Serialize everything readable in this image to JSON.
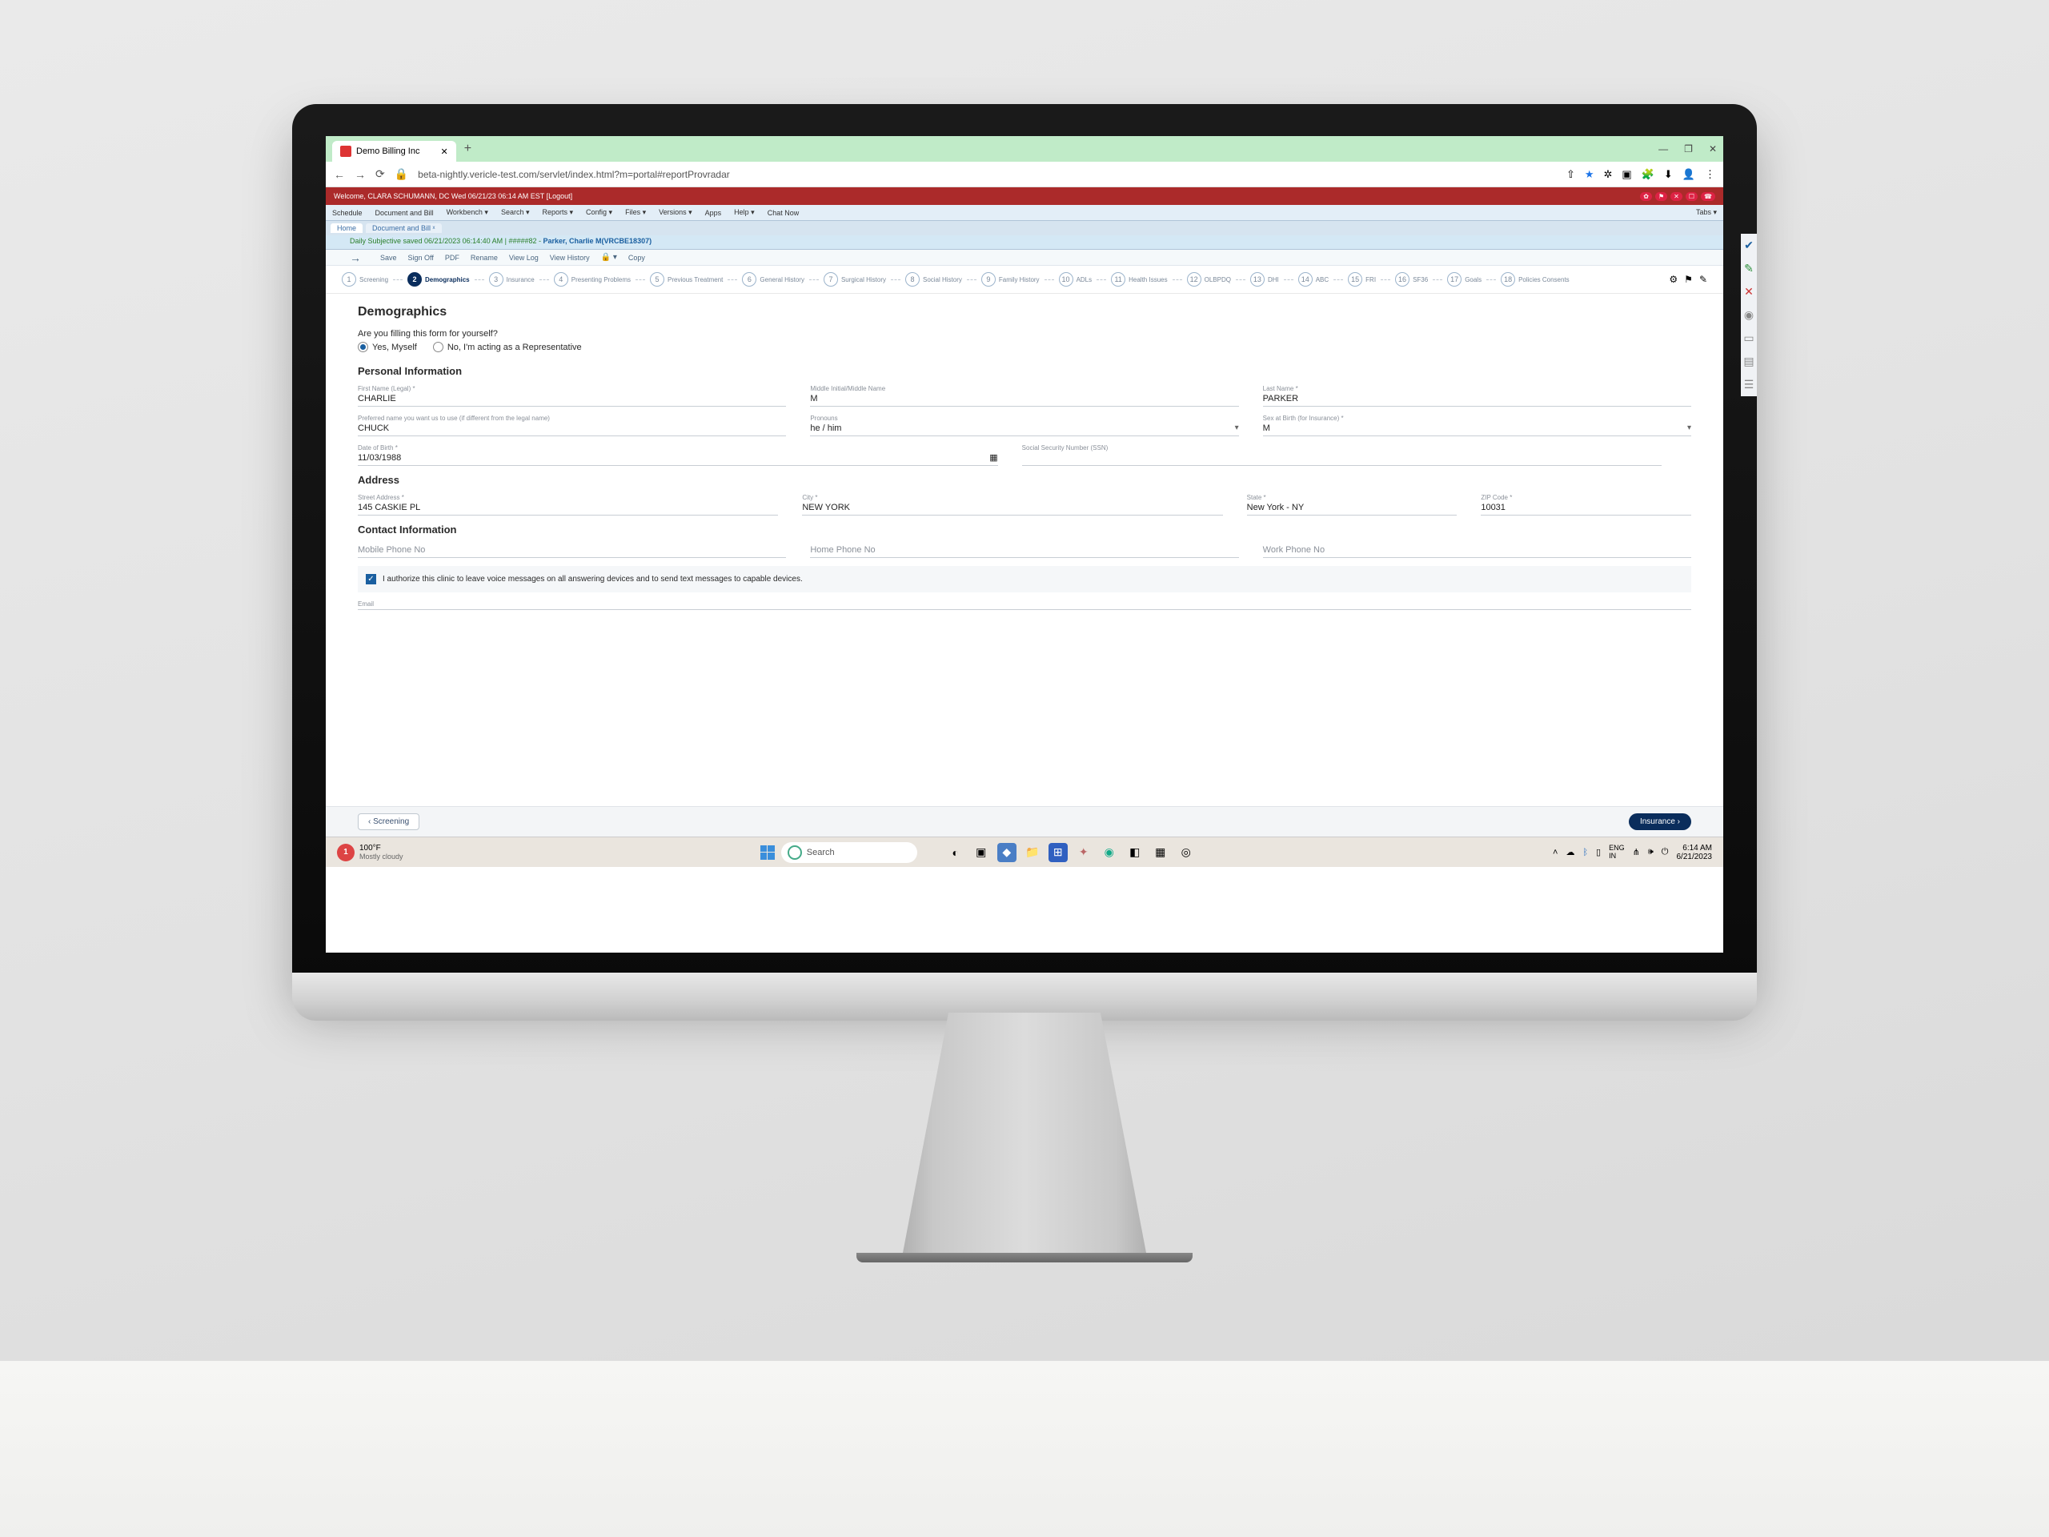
{
  "browser": {
    "tab_title": "Demo Billing Inc",
    "url": "beta-nightly.vericle-test.com/servlet/index.html?m=portal#reportProvradar",
    "minimize": "—",
    "restore": "❐",
    "close": "✕"
  },
  "header": {
    "welcome": "Welcome, CLARA SCHUMANN, DC   Wed 06/21/23 06:14 AM EST   [Logout]"
  },
  "menu": {
    "items": [
      "Schedule",
      "Document and Bill",
      "Workbench ▾",
      "Search ▾",
      "Reports ▾",
      "Config ▾",
      "Files ▾",
      "Versions ▾",
      "Apps",
      "Help ▾",
      "Chat Now"
    ],
    "right": "Tabs ▾"
  },
  "doctabs": {
    "home": "Home",
    "doc": "Document and Bill ˣ"
  },
  "banner": {
    "text1": "Daily Subjective saved 06/21/2023 06:14:40 AM | #####82 - ",
    "text2": "Parker, Charlie M(VRCBE18307)"
  },
  "actions": [
    "Save",
    "Sign Off",
    "PDF",
    "Rename",
    "View Log",
    "View History",
    "🔒 ▾",
    "Copy"
  ],
  "steps": [
    {
      "n": "1",
      "label": "Screening"
    },
    {
      "n": "2",
      "label": "Demographics"
    },
    {
      "n": "3",
      "label": "Insurance"
    },
    {
      "n": "4",
      "label": "Presenting Problems"
    },
    {
      "n": "5",
      "label": "Previous Treatment"
    },
    {
      "n": "6",
      "label": "General History"
    },
    {
      "n": "7",
      "label": "Surgical History"
    },
    {
      "n": "8",
      "label": "Social History"
    },
    {
      "n": "9",
      "label": "Family History"
    },
    {
      "n": "10",
      "label": "ADLs"
    },
    {
      "n": "11",
      "label": "Health Issues"
    },
    {
      "n": "12",
      "label": "OLBPDQ"
    },
    {
      "n": "13",
      "label": "DHI"
    },
    {
      "n": "14",
      "label": "ABC"
    },
    {
      "n": "15",
      "label": "FRI"
    },
    {
      "n": "16",
      "label": "SF36"
    },
    {
      "n": "17",
      "label": "Goals"
    },
    {
      "n": "18",
      "label": "Policies Consents"
    }
  ],
  "form": {
    "title": "Demographics",
    "yourself_q": "Are you filling this form for yourself?",
    "opt_yes": "Yes, Myself",
    "opt_no": "No, I'm acting as a Representative",
    "sec_personal": "Personal Information",
    "first_name_lbl": "First Name (Legal) *",
    "first_name": "CHARLIE",
    "middle_lbl": "Middle Initial/Middle Name",
    "middle": "M",
    "last_lbl": "Last Name *",
    "last": "PARKER",
    "pref_lbl": "Preferred name you want us to use (if different from the legal name)",
    "pref": "CHUCK",
    "pronoun_lbl": "Pronouns",
    "pronoun": "he / him",
    "sex_lbl": "Sex at Birth (for Insurance) *",
    "sex": "M",
    "dob_lbl": "Date of Birth *",
    "dob": "11/03/1988",
    "ssn_lbl": "Social Security Number (SSN)",
    "ssn": "",
    "sec_address": "Address",
    "street_lbl": "Street Address *",
    "street": "145 CASKIE PL",
    "city_lbl": "City *",
    "city": "NEW YORK",
    "state_lbl": "State *",
    "state": "New York - NY",
    "zip_lbl": "ZIP Code *",
    "zip": "10031",
    "sec_contact": "Contact Information",
    "mobile_lbl": "Mobile Phone No",
    "home_lbl": "Home Phone No",
    "work_lbl": "Work Phone No",
    "authorize": "I authorize this clinic to leave voice messages on all answering devices and to send text messages to capable devices.",
    "email_lbl": "Email"
  },
  "footer": {
    "prev": "Screening",
    "next": "Insurance"
  },
  "taskbar": {
    "temp": "100°F",
    "sky": "Mostly cloudy",
    "search": "Search",
    "lang": "ENG",
    "region": "IN",
    "time": "6:14 AM",
    "date": "6/21/2023"
  }
}
